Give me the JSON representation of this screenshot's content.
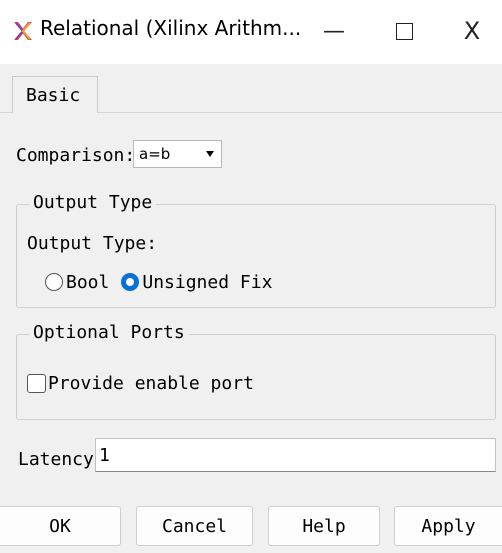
{
  "window": {
    "title": "Relational (Xilinx Arithm...",
    "minimize_glyph": "—",
    "close_glyph": "X",
    "icon": "xilinx-logo-icon"
  },
  "tabs": [
    {
      "label": "Basic",
      "selected": true
    }
  ],
  "comparison": {
    "label": "Comparison:",
    "value": "a=b"
  },
  "output_type_group": {
    "legend": "Output Type",
    "label": "Output Type:",
    "options": [
      {
        "label": "Bool",
        "selected": false
      },
      {
        "label": "Unsigned Fix",
        "selected": true
      }
    ]
  },
  "optional_ports_group": {
    "legend": "Optional Ports",
    "checkbox_label": "Provide enable port",
    "checked": false
  },
  "latency": {
    "label": "Latency",
    "value": "1"
  },
  "buttons": {
    "ok": "OK",
    "cancel": "Cancel",
    "help": "Help",
    "apply": "Apply"
  },
  "colors": {
    "accent": "#0a6fd8",
    "background": "#f0f0f0"
  }
}
